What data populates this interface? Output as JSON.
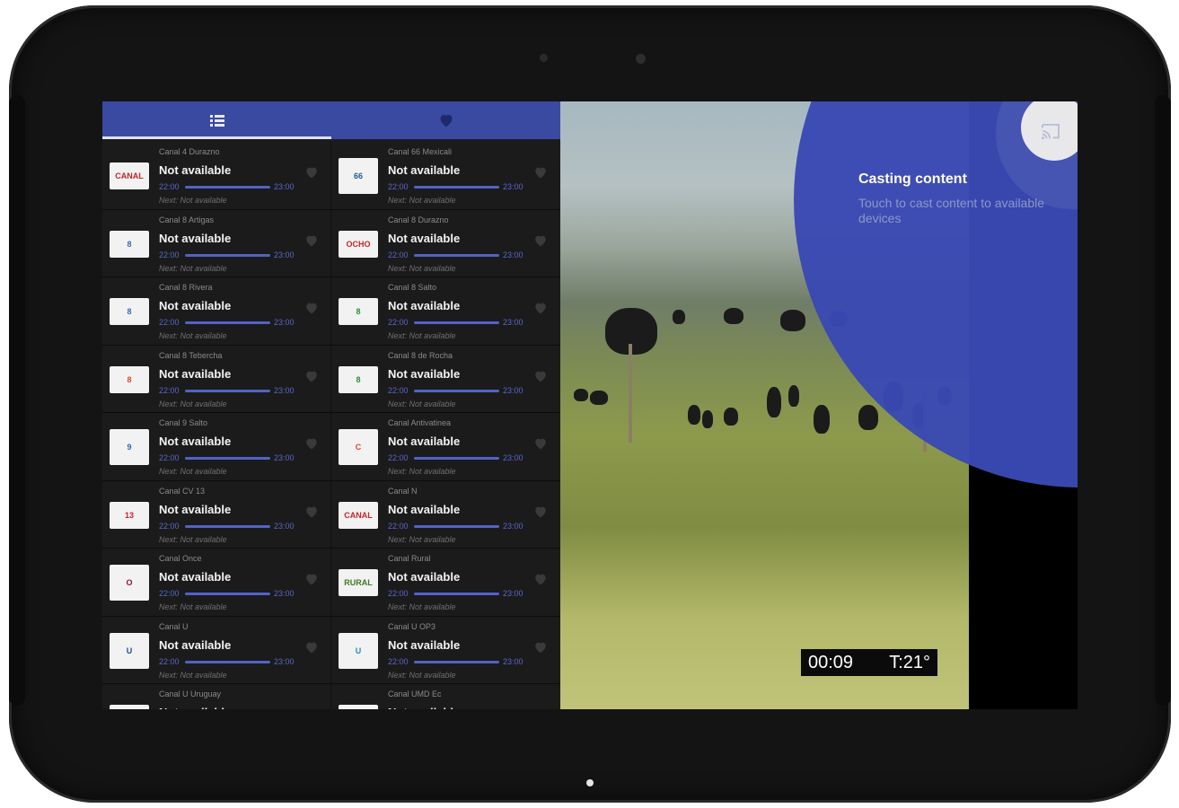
{
  "colors": {
    "accent": "#3a4aa0",
    "progress": "#5262c9",
    "cast_overlay": "#3a49b3"
  },
  "tabs": [
    {
      "icon": "list-icon",
      "active": true
    },
    {
      "icon": "heart-icon",
      "active": false
    }
  ],
  "channels": [
    [
      {
        "name": "Canal 4 Durazno",
        "now": "Not available",
        "start": "22:00",
        "end": "23:00",
        "next": "Next: Not available",
        "logo_text": "CANAL",
        "logo_color": "#c0262d"
      },
      {
        "name": "Canal 66 Mexicali",
        "now": "Not available",
        "start": "22:00",
        "end": "23:00",
        "next": "Next: Not available",
        "logo_text": "66",
        "logo_color": "#1a5e8f"
      }
    ],
    [
      {
        "name": "Canal 8 Artigas",
        "now": "Not available",
        "start": "22:00",
        "end": "23:00",
        "next": "Next: Not available",
        "logo_text": "8",
        "logo_color": "#3a6ab3"
      },
      {
        "name": "Canal 8 Durazno",
        "now": "Not available",
        "start": "22:00",
        "end": "23:00",
        "next": "Next: Not available",
        "logo_text": "OCHO",
        "logo_color": "#c0262d"
      }
    ],
    [
      {
        "name": "Canal 8 Rivera",
        "now": "Not available",
        "start": "22:00",
        "end": "23:00",
        "next": "Next: Not available",
        "logo_text": "8",
        "logo_color": "#3a6ab3"
      },
      {
        "name": "Canal 8 Salto",
        "now": "Not available",
        "start": "22:00",
        "end": "23:00",
        "next": "Next: Not available",
        "logo_text": "8",
        "logo_color": "#2c8c3a"
      }
    ],
    [
      {
        "name": "Canal 8 Tebercha",
        "now": "Not available",
        "start": "22:00",
        "end": "23:00",
        "next": "Next: Not available",
        "logo_text": "8",
        "logo_color": "#d34a2a"
      },
      {
        "name": "Canal 8 de Rocha",
        "now": "Not available",
        "start": "22:00",
        "end": "23:00",
        "next": "Next: Not available",
        "logo_text": "8",
        "logo_color": "#2c8c3a"
      }
    ],
    [
      {
        "name": "Canal 9 Salto",
        "now": "Not available",
        "start": "22:00",
        "end": "23:00",
        "next": "Next: Not available",
        "logo_text": "9",
        "logo_color": "#1f6fb3"
      },
      {
        "name": "Canal Antivatinea",
        "now": "Not available",
        "start": "22:00",
        "end": "23:00",
        "next": "Next: Not available",
        "logo_text": "C",
        "logo_color": "#e0452a"
      }
    ],
    [
      {
        "name": "Canal CV 13",
        "now": "Not available",
        "start": "22:00",
        "end": "23:00",
        "next": "Next: Not available",
        "logo_text": "13",
        "logo_color": "#c0262d"
      },
      {
        "name": "Canal N",
        "now": "Not available",
        "start": "22:00",
        "end": "23:00",
        "next": "Next: Not available",
        "logo_text": "CANAL",
        "logo_color": "#c0262d"
      }
    ],
    [
      {
        "name": "Canal Once",
        "now": "Not available",
        "start": "22:00",
        "end": "23:00",
        "next": "Next: Not available",
        "logo_text": "O",
        "logo_color": "#8a1538"
      },
      {
        "name": "Canal Rural",
        "now": "Not available",
        "start": "22:00",
        "end": "23:00",
        "next": "Next: Not available",
        "logo_text": "RURAL",
        "logo_color": "#3d7a1f"
      }
    ],
    [
      {
        "name": "Canal U",
        "now": "Not available",
        "start": "22:00",
        "end": "23:00",
        "next": "Next: Not available",
        "logo_text": "U",
        "logo_color": "#1f4f9c"
      },
      {
        "name": "Canal U OP3",
        "now": "Not available",
        "start": "22:00",
        "end": "23:00",
        "next": "Next: Not available",
        "logo_text": "U",
        "logo_color": "#1f8fc9"
      }
    ],
    [
      {
        "name": "Canal U Uruguay",
        "now": "Not available",
        "start": "",
        "end": "",
        "next": "",
        "logo_text": "",
        "logo_color": "#ffffff"
      },
      {
        "name": "Canal UMD Ec",
        "now": "Not available",
        "start": "",
        "end": "",
        "next": "",
        "logo_text": "",
        "logo_color": "#ffffff"
      }
    ]
  ],
  "video": {
    "time": "00:09",
    "temp": "T:21°"
  },
  "cast": {
    "title": "Casting content",
    "description": "Touch to cast content to available devices",
    "icon": "cast-icon"
  }
}
